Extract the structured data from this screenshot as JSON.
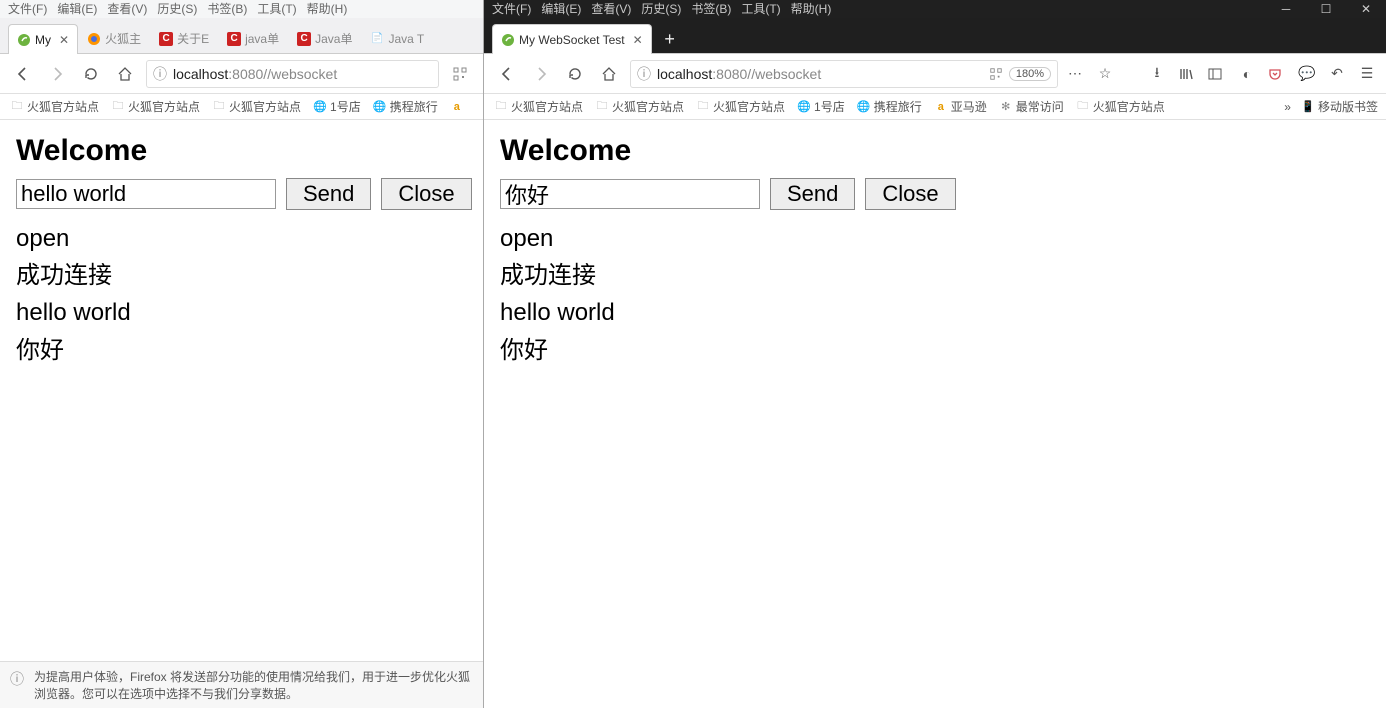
{
  "left": {
    "menubar": [
      "文件(F)",
      "编辑(E)",
      "查看(V)",
      "历史(S)",
      "书签(B)",
      "工具(T)",
      "帮助(H)"
    ],
    "tabs": [
      {
        "label": "My",
        "active": true,
        "icon": "spring"
      },
      {
        "label": "火狐主",
        "icon": "firefox"
      },
      {
        "label": "关于E",
        "icon": "c"
      },
      {
        "label": "java单",
        "icon": "c"
      },
      {
        "label": "Java单",
        "icon": "c"
      },
      {
        "label": "Java T",
        "icon": "doc"
      }
    ],
    "url": {
      "prefix": "ⓘ",
      "host": "localhost",
      "rest": ":8080//websocket"
    },
    "bookmarks": [
      {
        "icon": "folder",
        "label": "火狐官方站点"
      },
      {
        "icon": "folder",
        "label": "火狐官方站点"
      },
      {
        "icon": "folder",
        "label": "火狐官方站点"
      },
      {
        "icon": "globe",
        "label": "1号店"
      },
      {
        "icon": "globe",
        "label": "携程旅行"
      }
    ],
    "bookmarks_trail": "a",
    "page": {
      "title": "Welcome",
      "input_value": "hello world",
      "send_label": "Send",
      "close_label": "Close",
      "messages": [
        "open",
        "成功连接",
        "hello world",
        "你好"
      ]
    },
    "notice": "为提高用户体验，Firefox 将发送部分功能的使用情况给我们，用于进一步优化火狐浏览器。您可以在选项中选择不与我们分享数据。"
  },
  "right": {
    "menubar": [
      "文件(F)",
      "编辑(E)",
      "查看(V)",
      "历史(S)",
      "书签(B)",
      "工具(T)",
      "帮助(H)"
    ],
    "tab_title": "My WebSocket Test",
    "url": {
      "prefix": "ⓘ",
      "host": "localhost",
      "rest": ":8080//websocket"
    },
    "zoom": "180%",
    "bookmarks": [
      {
        "icon": "folder",
        "label": "火狐官方站点"
      },
      {
        "icon": "folder",
        "label": "火狐官方站点"
      },
      {
        "icon": "folder",
        "label": "火狐官方站点"
      },
      {
        "icon": "globe",
        "label": "1号店"
      },
      {
        "icon": "globe",
        "label": "携程旅行"
      },
      {
        "icon": "a",
        "label": "亚马逊"
      },
      {
        "icon": "gear",
        "label": "最常访问"
      },
      {
        "icon": "folder",
        "label": "火狐官方站点"
      }
    ],
    "bookmarks_right": {
      "label": "移动版书签"
    },
    "page": {
      "title": "Welcome",
      "input_value": "你好",
      "send_label": "Send",
      "close_label": "Close",
      "messages": [
        "open",
        "成功连接",
        "hello world",
        "你好"
      ]
    }
  }
}
